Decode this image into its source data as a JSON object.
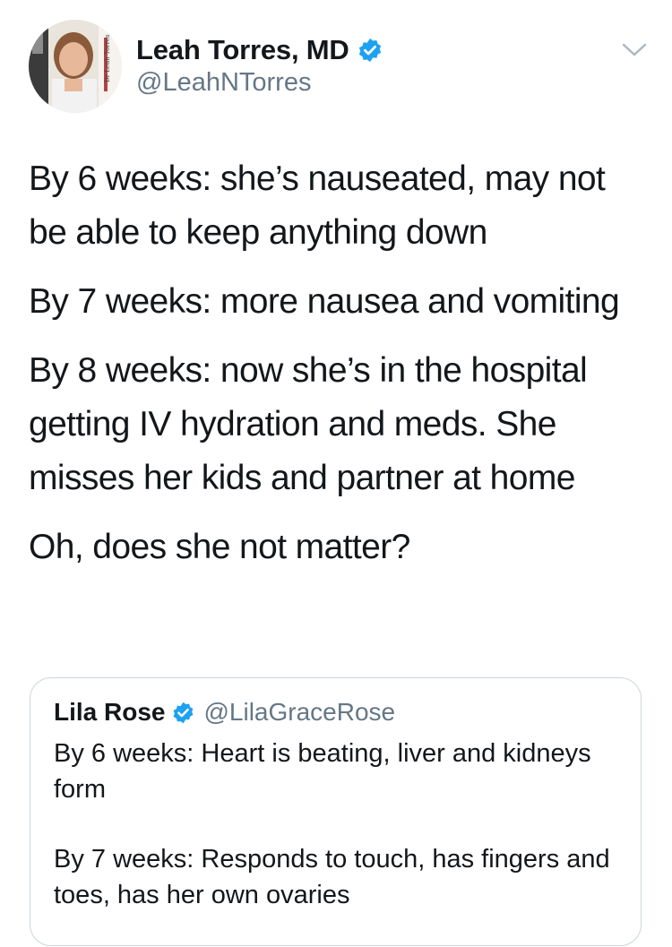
{
  "author": {
    "display_name": "Leah Torres, MD",
    "handle": "@LeahNTorres",
    "verified": true,
    "avatar_icon": "profile-photo"
  },
  "tweet": {
    "paragraphs": [
      "By 6 weeks: she’s nauseated, may not be able to keep anything down",
      "By 7 weeks: more nausea and vomiting",
      "By 8 weeks: now she’s in the hospital getting IV hydration and meds. She misses her kids and partner at home",
      "Oh, does she not matter?"
    ]
  },
  "quoted_tweet": {
    "display_name": "Lila Rose",
    "handle": "@LilaGraceRose",
    "verified": true,
    "paragraphs": [
      "By 6 weeks: Heart is beating, liver and kidneys form",
      "By 7 weeks: Responds to touch, has fingers and toes, has her own ovaries"
    ]
  },
  "colors": {
    "verified_blue": "#1da1f2",
    "text": "#14171a",
    "secondary_text": "#657786",
    "border": "#ccd6dd"
  },
  "icons": {
    "menu": "chevron-down-icon",
    "verified": "verified-badge-icon"
  }
}
